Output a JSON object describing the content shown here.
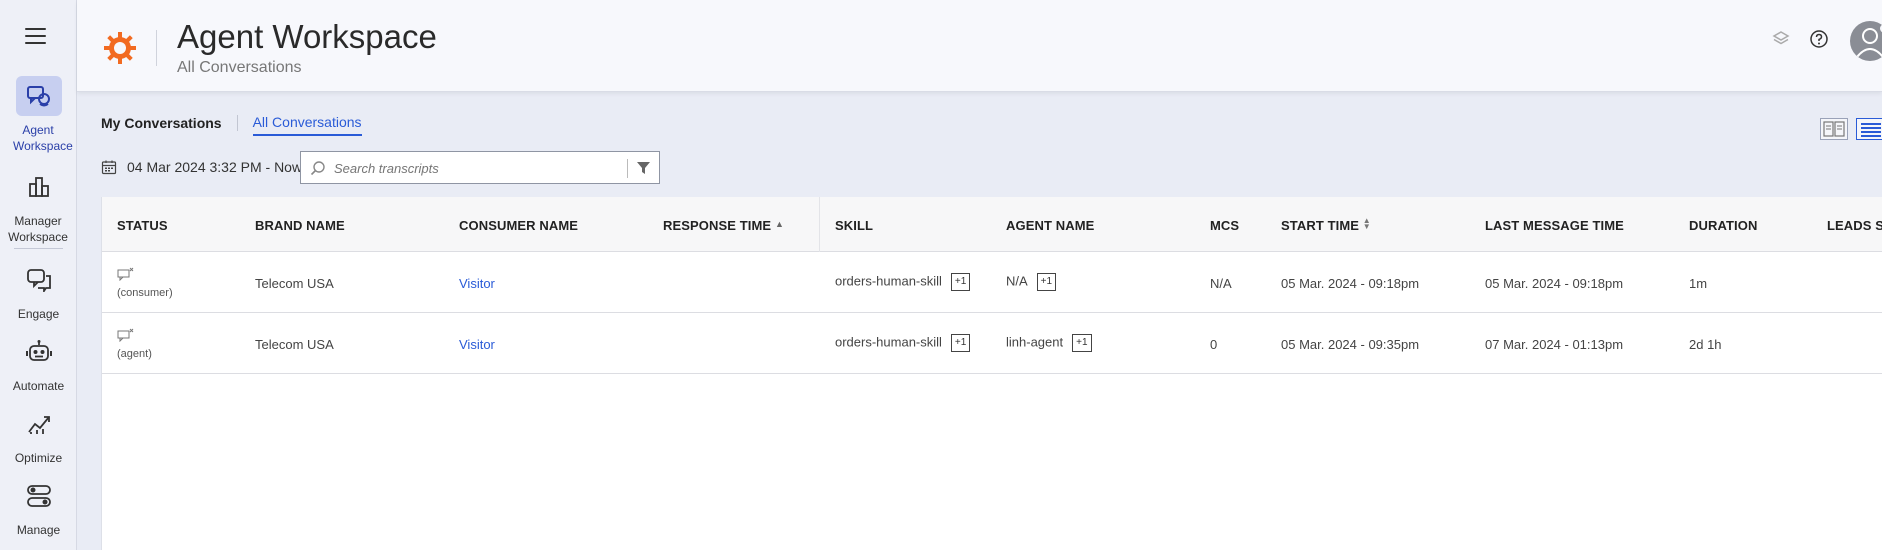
{
  "sidebar": {
    "items": [
      {
        "label": "Agent Workspace",
        "icon": "agent-workspace-icon",
        "active": true
      },
      {
        "label": "Manager Workspace",
        "icon": "manager-workspace-icon",
        "active": false
      },
      {
        "label": "Engage",
        "icon": "engage-icon",
        "active": false
      },
      {
        "label": "Automate",
        "icon": "robot-icon",
        "active": false
      },
      {
        "label": "Optimize",
        "icon": "trend-chart-icon",
        "active": false
      },
      {
        "label": "Manage",
        "icon": "toggles-icon",
        "active": false
      }
    ]
  },
  "header": {
    "title": "Agent Workspace",
    "subtitle": "All Conversations"
  },
  "tabs": {
    "mine": "My Conversations",
    "all": "All Conversations"
  },
  "filters": {
    "date_range": "04 Mar 2024 3:32 PM - Now",
    "search_placeholder": "Search transcripts"
  },
  "table": {
    "columns": [
      "STATUS",
      "BRAND NAME",
      "CONSUMER NAME",
      "RESPONSE TIME",
      "SKILL",
      "AGENT NAME",
      "MCS",
      "START TIME",
      "LAST MESSAGE TIME",
      "DURATION",
      "LEADS S..."
    ],
    "rows": [
      {
        "status": "(consumer)",
        "brand": "Telecom USA",
        "consumer": "Visitor",
        "response_time": "",
        "skill": "orders-human-skill",
        "skill_extra": "+1",
        "agent": "N/A",
        "agent_extra": "+1",
        "mcs": "N/A",
        "start": "05 Mar. 2024 - 09:18pm",
        "last": "05 Mar. 2024 - 09:18pm",
        "duration": "1m"
      },
      {
        "status": "(agent)",
        "brand": "Telecom USA",
        "consumer": "Visitor",
        "response_time": "",
        "skill": "orders-human-skill",
        "skill_extra": "+1",
        "agent": "linh-agent",
        "agent_extra": "+1",
        "mcs": "0",
        "start": "05 Mar. 2024 - 09:35pm",
        "last": "07 Mar. 2024 - 01:13pm",
        "duration": "2d 1h"
      }
    ]
  },
  "colors": {
    "accent": "#2a5bd7",
    "logo": "#f26b21",
    "active_nav_bg": "#c7cff0",
    "presence": "#2fb456"
  }
}
